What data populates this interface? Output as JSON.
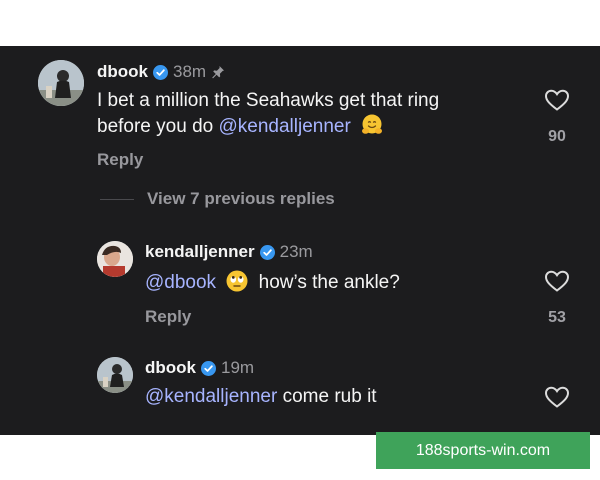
{
  "comments": [
    {
      "username": "dbook",
      "time": "38m",
      "pinned": true,
      "text_line1": "I bet a million the Seahawks get that ring",
      "text_line2_pre": "before you do ",
      "mention": "@kendalljenner",
      "emoji": "hugging-face-emoji",
      "reply_label": "Reply",
      "likes": "90"
    },
    {
      "username": "kendalljenner",
      "time": "23m",
      "mention": "@dbook",
      "emoji": "rolling-eyes-emoji",
      "text_after": "how’s the ankle?",
      "reply_label": "Reply",
      "likes": "53"
    },
    {
      "username": "dbook",
      "time": "19m",
      "mention": "@kendalljenner",
      "text_after": " come rub it"
    }
  ],
  "view_previous_label": "View 7 previous replies",
  "watermark_text": "188sports-win.com",
  "colors": {
    "background": "#1c1c1e",
    "mention": "#a7b4ff",
    "verified": "#3897f0",
    "secondary_text": "#98989d",
    "watermark_bg": "#3fa35a"
  }
}
